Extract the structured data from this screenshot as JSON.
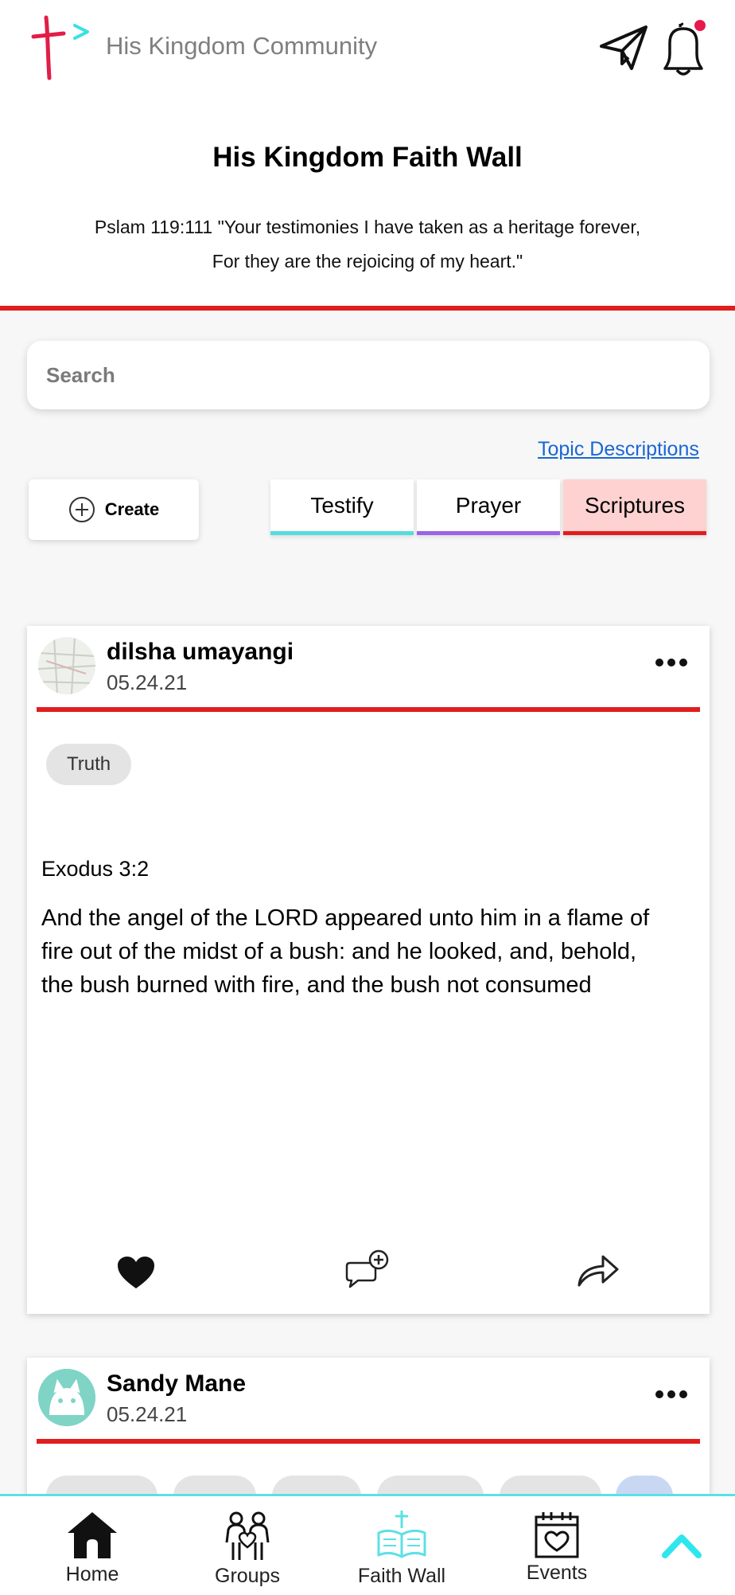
{
  "header": {
    "app_title": "His Kingdom Community",
    "icons": {
      "send": "send-icon",
      "bell": "bell-icon"
    },
    "notification_dot_color": "#e8194b"
  },
  "intro": {
    "title": "His Kingdom Faith Wall",
    "verse_line1": "Pslam 119:111 \"Your testimonies I have taken as a heritage forever,",
    "verse_line2": "For they are the rejoicing of my heart.\""
  },
  "search": {
    "placeholder": "Search"
  },
  "topic_link": "Topic Descriptions",
  "create_label": "Create",
  "tabs": [
    {
      "label": "Testify",
      "color": "#56dce0"
    },
    {
      "label": "Prayer",
      "color": "#9a63e6"
    },
    {
      "label": "Scriptures",
      "color": "#e11d1d",
      "selected": true
    }
  ],
  "posts": [
    {
      "author": "dilsha umayangi",
      "date": "05.24.21",
      "tags": [
        "Truth"
      ],
      "reference": "Exodus 3:2",
      "text_lines": [
        "And the angel of the LORD appeared unto him in a flame of",
        "fire out of the midst of a bush: and he looked, and, behold,",
        "the bush burned with fire, and the bush not consumed"
      ]
    },
    {
      "author": "Sandy Mane",
      "date": "05.24.21"
    }
  ],
  "bottom_nav": [
    {
      "label": "Home",
      "icon": "home-icon"
    },
    {
      "label": "Groups",
      "icon": "groups-icon"
    },
    {
      "label": "Faith Wall",
      "icon": "faith-wall-icon",
      "active": true
    },
    {
      "label": "Events",
      "icon": "events-icon"
    }
  ],
  "colors": {
    "accent_red": "#e11d1d",
    "accent_cyan": "#5ce0e6",
    "link": "#1a66d4"
  }
}
